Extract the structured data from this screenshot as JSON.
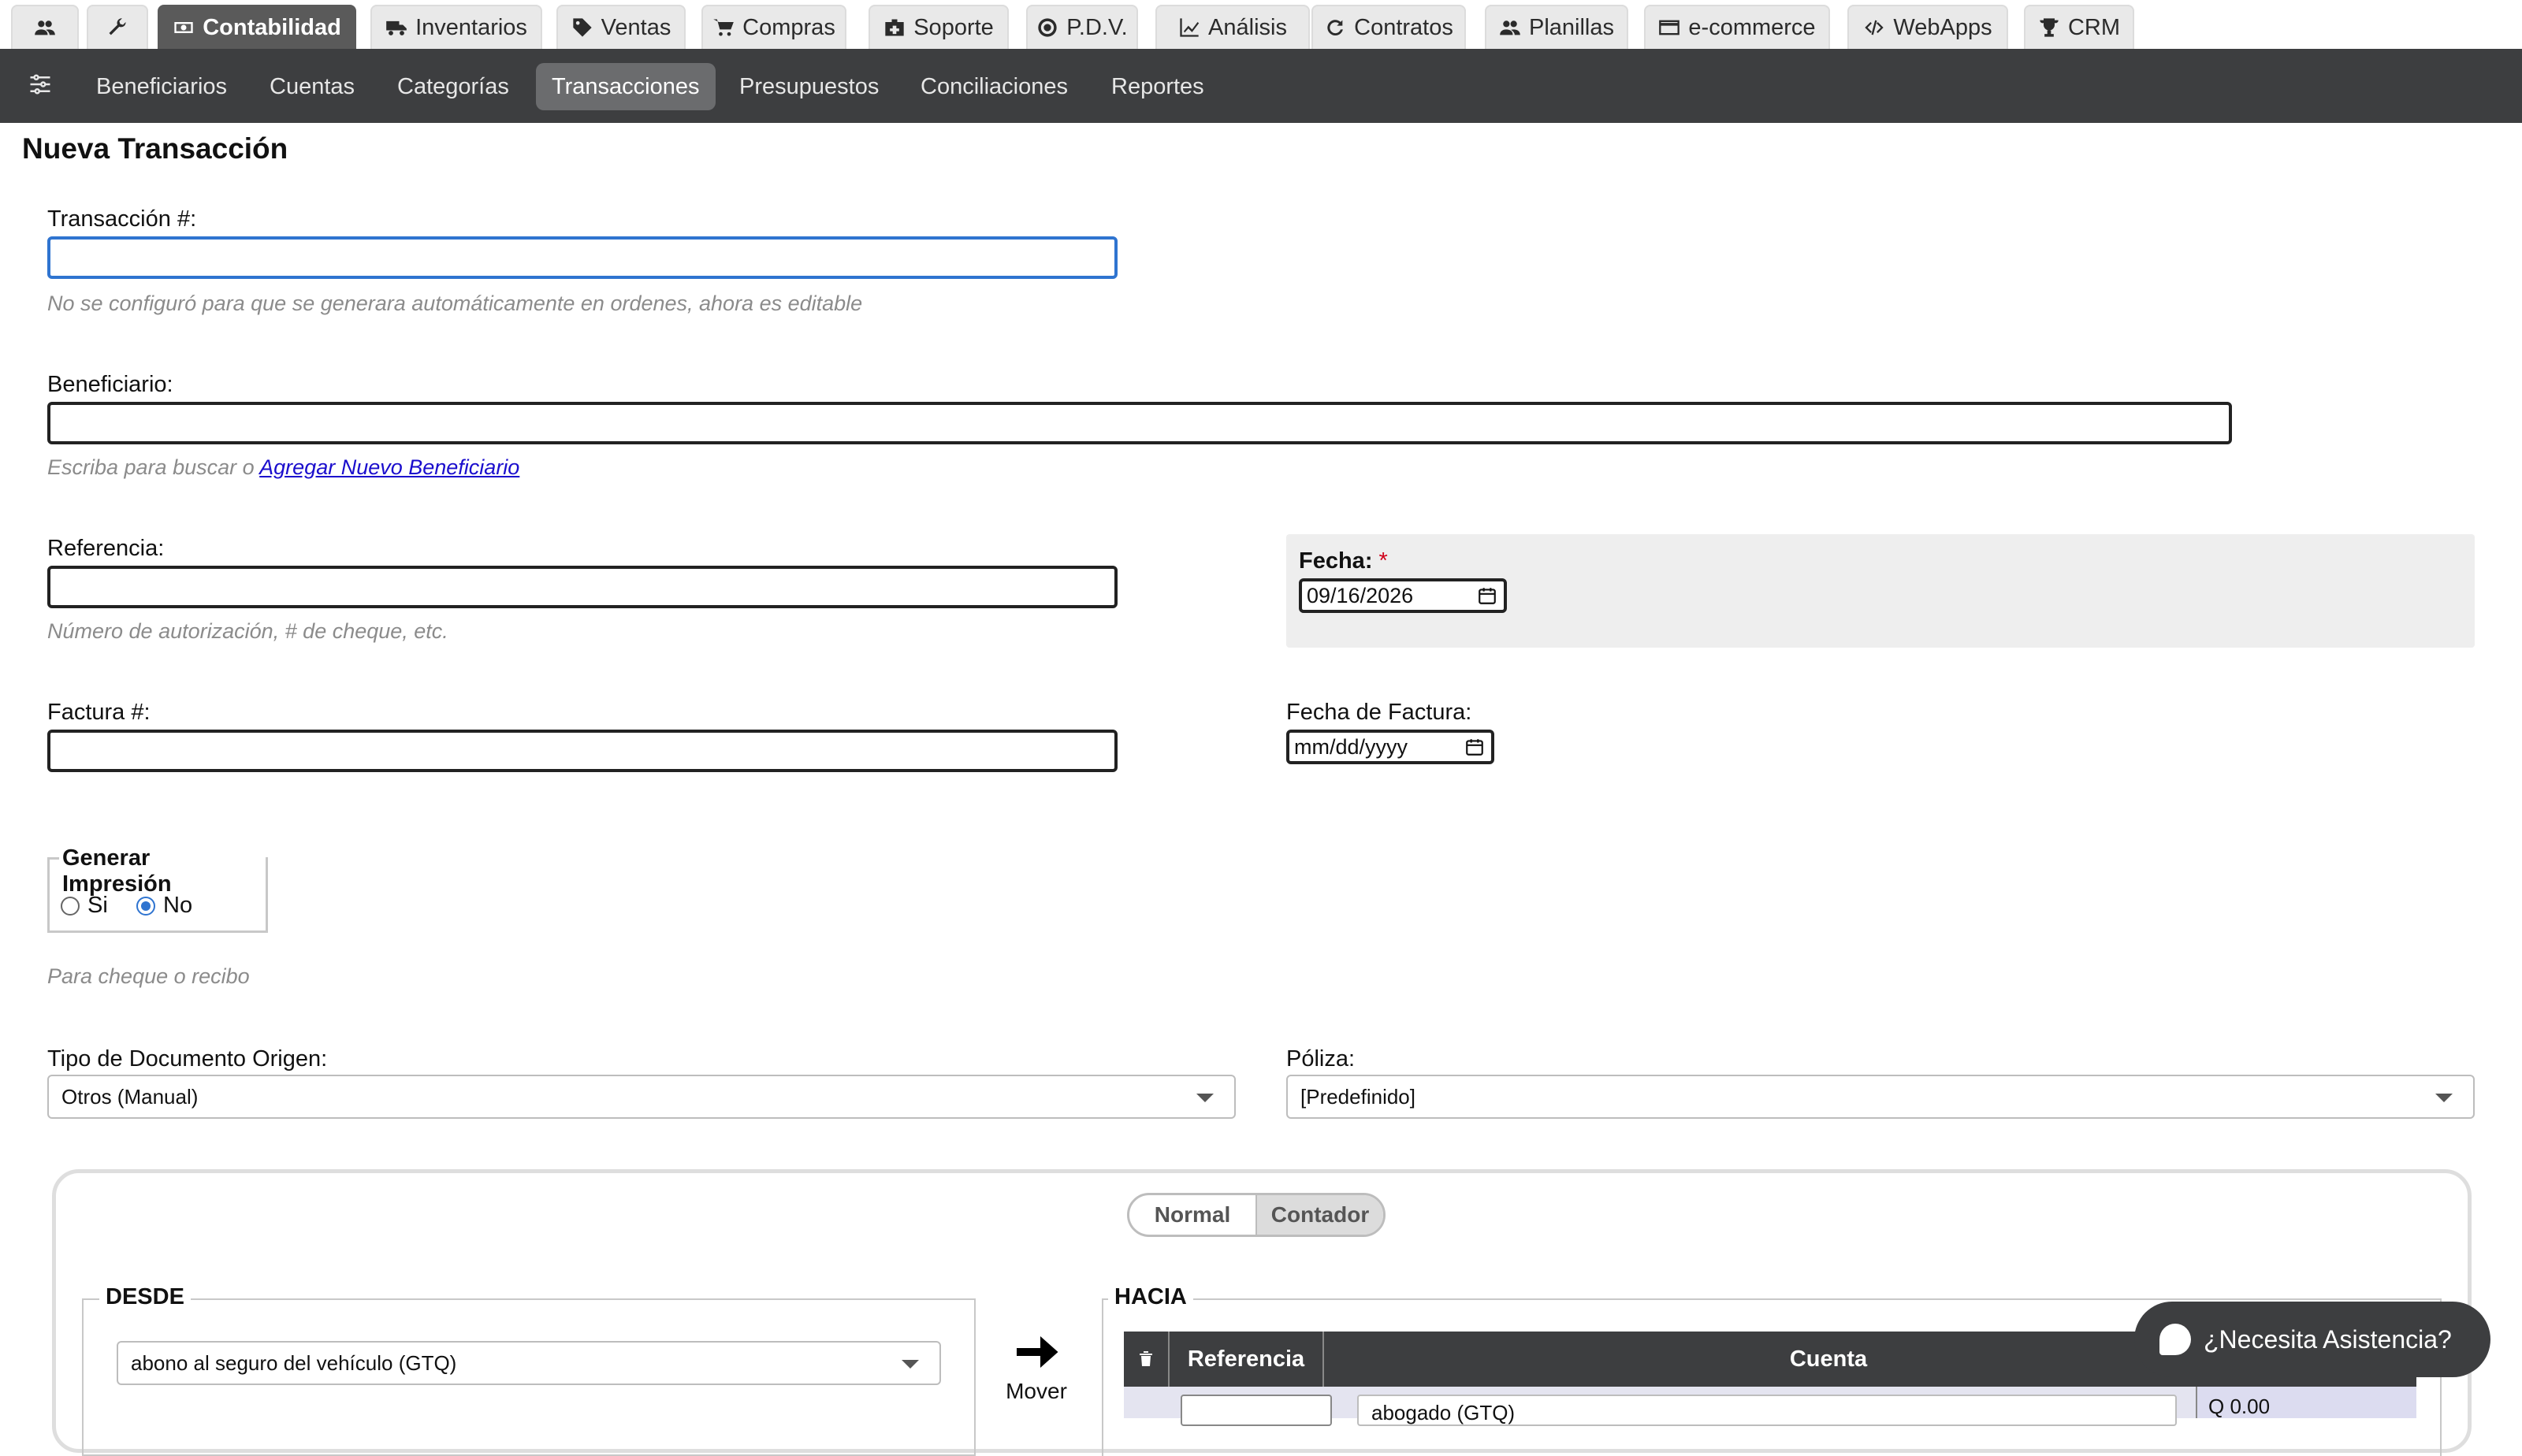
{
  "top_tabs": [
    {
      "icon": "users-icon",
      "label": ""
    },
    {
      "icon": "wrench-icon",
      "label": ""
    },
    {
      "icon": "money-icon",
      "label": "Contabilidad",
      "active": true
    },
    {
      "icon": "truck-icon",
      "label": "Inventarios"
    },
    {
      "icon": "tag-icon",
      "label": "Ventas"
    },
    {
      "icon": "cart-icon",
      "label": "Compras"
    },
    {
      "icon": "medkit-icon",
      "label": "Soporte"
    },
    {
      "icon": "target-icon",
      "label": "P.D.V."
    },
    {
      "icon": "chart-line-icon",
      "label": "Análisis"
    },
    {
      "icon": "refresh-icon",
      "label": "Contratos"
    },
    {
      "icon": "users-icon",
      "label": "Planillas"
    },
    {
      "icon": "credit-card-icon",
      "label": "e-commerce"
    },
    {
      "icon": "code-icon",
      "label": "WebApps"
    },
    {
      "icon": "trophy-icon",
      "label": "CRM"
    }
  ],
  "subnav": {
    "icon": "sliders-icon",
    "items": [
      "Beneficiarios",
      "Cuentas",
      "Categorías",
      "Transacciones",
      "Presupuestos",
      "Conciliaciones",
      "Reportes"
    ],
    "active": "Transacciones"
  },
  "form": {
    "title": "Nueva Transacción",
    "transaccion_label": "Transacción #:",
    "transaccion_value": "",
    "transaccion_help": "No se configuró para que se generara automáticamente en ordenes, ahora es editable",
    "beneficiario_label": "Beneficiario:",
    "beneficiario_value": "",
    "beneficiario_help": "Escriba para buscar o",
    "beneficiario_link": "Agregar Nuevo Beneficiario",
    "referencia_label": "Referencia:",
    "referencia_value": "",
    "referencia_help": "Número de autorización, # de cheque, etc.",
    "fecha_label": "Fecha:",
    "fecha_required": "*",
    "fecha_value": "09/16/2026",
    "factura_label": "Factura #:",
    "factura_value": "",
    "fecha_factura_label": "Fecha de Factura:",
    "fecha_factura_value": "mm/dd/yyyy",
    "impresion_legend": "Generar Impresión",
    "impresion_options": [
      "Si",
      "No"
    ],
    "impresion_selected": "No",
    "impresion_help": "Para cheque o recibo",
    "tipo_doc_label": "Tipo de Documento Origen:",
    "tipo_doc_value": "Otros (Manual)",
    "poliza_label": "Póliza:",
    "poliza_value": "[Predefinido]"
  },
  "panel": {
    "toggle": [
      "Normal",
      "Contador"
    ],
    "toggle_selected": "Contador",
    "desde_legend": "DESDE",
    "desde_value": "abono al seguro del vehículo (GTQ)",
    "mover_label": "Mover",
    "hacia_legend": "HACIA",
    "columns": [
      "Referencia",
      "Cuenta"
    ],
    "row": {
      "referencia": "",
      "cuenta": "abogado (GTQ)",
      "monto": "Q 0.00"
    }
  },
  "help_button": "¿Necesita Asistencia?",
  "colors": {
    "accent": "#2f74d0",
    "dark": "#3d3e40",
    "required": "#d0021b",
    "link": "#1a0dcd"
  }
}
